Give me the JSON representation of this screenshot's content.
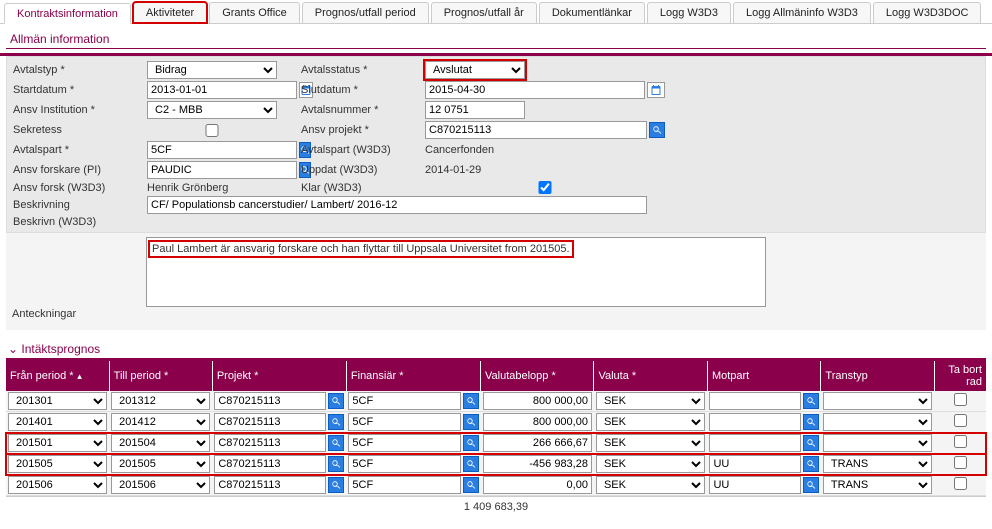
{
  "tabs": [
    {
      "label": "Kontraktsinformation",
      "active": true
    },
    {
      "label": "Aktiviteter",
      "highlight": true
    },
    {
      "label": "Grants Office"
    },
    {
      "label": "Prognos/utfall period"
    },
    {
      "label": "Prognos/utfall år"
    },
    {
      "label": "Dokumentlänkar"
    },
    {
      "label": "Logg W3D3"
    },
    {
      "label": "Logg Allmäninfo W3D3"
    },
    {
      "label": "Logg W3D3DOC"
    }
  ],
  "section_general": "Allmän information",
  "form": {
    "avtalstyp_label": "Avtalstyp *",
    "avtalstyp_value": "Bidrag",
    "avtalsstatus_label": "Avtalsstatus *",
    "avtalsstatus_value": "Avslutat",
    "startdatum_label": "Startdatum *",
    "startdatum_value": "2013-01-01",
    "slutdatum_label": "Slutdatum *",
    "slutdatum_value": "2015-04-30",
    "ansv_inst_label": "Ansv Institution *",
    "ansv_inst_value": "C2 - MBB",
    "avtalsnummer_label": "Avtalsnummer *",
    "avtalsnummer_value": "12 0751",
    "sekretess_label": "Sekretess",
    "sekretess_value": false,
    "ansv_projekt_label": "Ansv projekt *",
    "ansv_projekt_value": "C870215113",
    "avtalspart_label": "Avtalspart *",
    "avtalspart_value": "5CF",
    "avtalspart_w3d3_label": "Avtalspart (W3D3)",
    "avtalspart_w3d3_value": "Cancerfonden",
    "ansv_forskare_label": "Ansv forskare (PI)",
    "ansv_forskare_value": "PAUDIC",
    "uppdat_label": "Uppdat (W3D3)",
    "uppdat_value": "2014-01-29",
    "ansv_forsk_w3d3_label": "Ansv forsk (W3D3)",
    "ansv_forsk_w3d3_value": "Henrik Grönberg",
    "klar_label": "Klar (W3D3)",
    "klar_value": true,
    "beskrivning_label": "Beskrivning",
    "beskrivning_value": "CF/ Populationsb cancerstudier/ Lambert/ 2016-12",
    "beskrivn_w3d3_label": "Beskrivn (W3D3)",
    "anteckningar_label": "Anteckningar",
    "anteckningar_value": "Paul Lambert är ansvarig forskare och han flyttar till Uppsala Universitet from 201505."
  },
  "section_forecast": "Intäktsprognos",
  "table": {
    "headers": {
      "fran": "Från period *",
      "till": "Till period *",
      "projekt": "Projekt *",
      "finansiar": "Finansiär *",
      "valutabelopp": "Valutabelopp *",
      "valuta": "Valuta *",
      "motpart": "Motpart",
      "transtyp": "Transtyp",
      "tabort": "Ta bort rad"
    },
    "rows": [
      {
        "fran": "201301",
        "till": "201312",
        "projekt": "C870215113",
        "finansiar": "5CF",
        "belopp": "800 000,00",
        "valuta": "SEK",
        "motpart": "",
        "transtyp": ""
      },
      {
        "fran": "201401",
        "till": "201412",
        "projekt": "C870215113",
        "finansiar": "5CF",
        "belopp": "800 000,00",
        "valuta": "SEK",
        "motpart": "",
        "transtyp": ""
      },
      {
        "fran": "201501",
        "till": "201504",
        "projekt": "C870215113",
        "finansiar": "5CF",
        "belopp": "266 666,67",
        "valuta": "SEK",
        "motpart": "",
        "transtyp": "",
        "hl": true
      },
      {
        "fran": "201505",
        "till": "201505",
        "projekt": "C870215113",
        "finansiar": "5CF",
        "belopp": "-456 983,28",
        "valuta": "SEK",
        "motpart": "UU",
        "transtyp": "TRANS",
        "hl": true
      },
      {
        "fran": "201506",
        "till": "201506",
        "projekt": "C870215113",
        "finansiar": "5CF",
        "belopp": "0,00",
        "valuta": "SEK",
        "motpart": "UU",
        "transtyp": "TRANS"
      }
    ],
    "sum": "1 409 683,39"
  }
}
